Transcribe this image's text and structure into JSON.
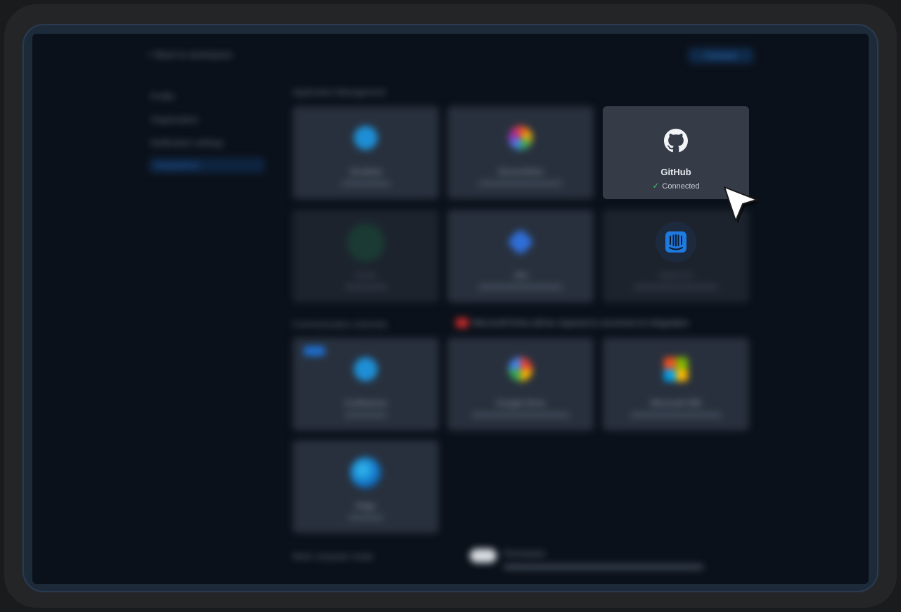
{
  "topbar": {
    "title": "< Back to workspace",
    "action": "Connect"
  },
  "sidebar": {
    "items": [
      {
        "label": "Profile"
      },
      {
        "label": "Organization"
      },
      {
        "label": "Notification settings"
      },
      {
        "label": "Integrations"
      }
    ]
  },
  "sections": {
    "app_management": "Application Management",
    "communication": "Communication channels",
    "warning": "Microsoft Entra will be required to reconnect to integration",
    "work_computer": "Work computer mode"
  },
  "cards": {
    "zendesk": {
      "name": "Zendesk"
    },
    "service_now": {
      "name": "ServiceNow"
    },
    "github": {
      "name": "GitHub",
      "status": "Connected"
    },
    "zoom": {
      "name": "Zoom"
    },
    "jira": {
      "name": "Jira"
    },
    "intercom": {
      "name": "Intercom"
    },
    "atlassian": {
      "name": "Confluence"
    },
    "google": {
      "name": "Google Drive"
    },
    "microsoft": {
      "name": "Microsoft 365"
    },
    "edge": {
      "name": "Edge"
    }
  },
  "toggle": {
    "label": "Permission"
  },
  "colors": {
    "accent": "#1d6fd0",
    "connected": "#3fbf6a",
    "warning": "#c22a2a"
  }
}
